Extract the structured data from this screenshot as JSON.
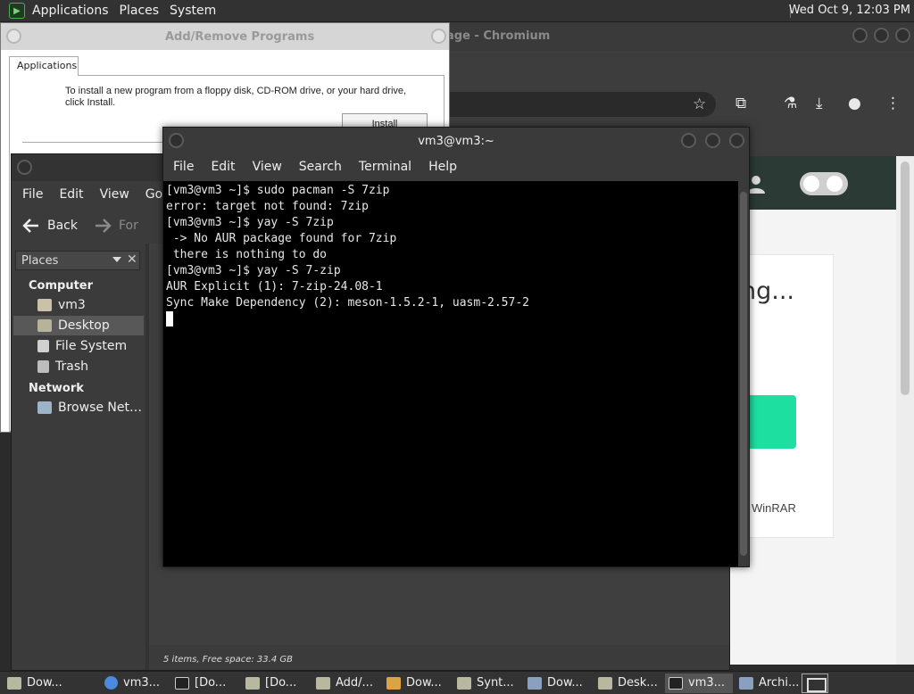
{
  "top_panel": {
    "menus": [
      "Applications",
      "Places",
      "System"
    ],
    "clock": "Wed Oct  9, 12:03 PM"
  },
  "chromium": {
    "title": "age - Chromium",
    "page_heading": "ng...",
    "page_text": "WinRAR"
  },
  "add_remove": {
    "title": "Add/Remove Programs",
    "tab_label": "Applications",
    "instructions": "To install a new program from a floppy disk, CD-ROM drive, or your hard drive, click Install.",
    "install_label": "Install"
  },
  "file_manager": {
    "menus": [
      "File",
      "Edit",
      "View",
      "Go"
    ],
    "back_label": "Back",
    "forward_label": "For",
    "places_label": "Places",
    "computer_heading": "Computer",
    "network_heading": "Network",
    "items": [
      "vm3",
      "Desktop",
      "File System",
      "Trash"
    ],
    "network_items": [
      "Browse Net…"
    ],
    "status": "5 items, Free space: 33.4 GB"
  },
  "terminal": {
    "title": "vm3@vm3:~",
    "menus": [
      "File",
      "Edit",
      "View",
      "Search",
      "Terminal",
      "Help"
    ],
    "lines": [
      "[vm3@vm3 ~]$ sudo pacman -S 7zip",
      "error: target not found: 7zip",
      "[vm3@vm3 ~]$ yay -S 7zip",
      " -> No AUR package found for 7zip",
      " there is nothing to do",
      "[vm3@vm3 ~]$ yay -S 7-zip",
      "AUR Explicit (1): 7-zip-24.08-1",
      "Sync Make Dependency (2): meson-1.5.2-1, uasm-2.57-2"
    ]
  },
  "taskbar": {
    "tasks": [
      {
        "label": "Dow...",
        "icon": "folder-icon"
      },
      {
        "label": "vm3...",
        "icon": "chromium-icon"
      },
      {
        "label": "[Do...",
        "icon": "terminal-icon"
      },
      {
        "label": "[Do...",
        "icon": "folder-icon"
      },
      {
        "label": "Add/...",
        "icon": "folder-icon"
      },
      {
        "label": "Dow...",
        "icon": "package-icon"
      },
      {
        "label": "Synt...",
        "icon": "folder-icon"
      },
      {
        "label": "Dow...",
        "icon": "synaptic-icon"
      },
      {
        "label": "Desk...",
        "icon": "folder-icon"
      },
      {
        "label": "vm3...",
        "icon": "folder-icon"
      },
      {
        "label": "Archi...",
        "icon": "terminal-icon"
      }
    ]
  },
  "colors": {
    "panel_bg": "#323232",
    "terminal_bg": "#000000",
    "accent_green": "#1de0a0",
    "selection": "#585858"
  }
}
